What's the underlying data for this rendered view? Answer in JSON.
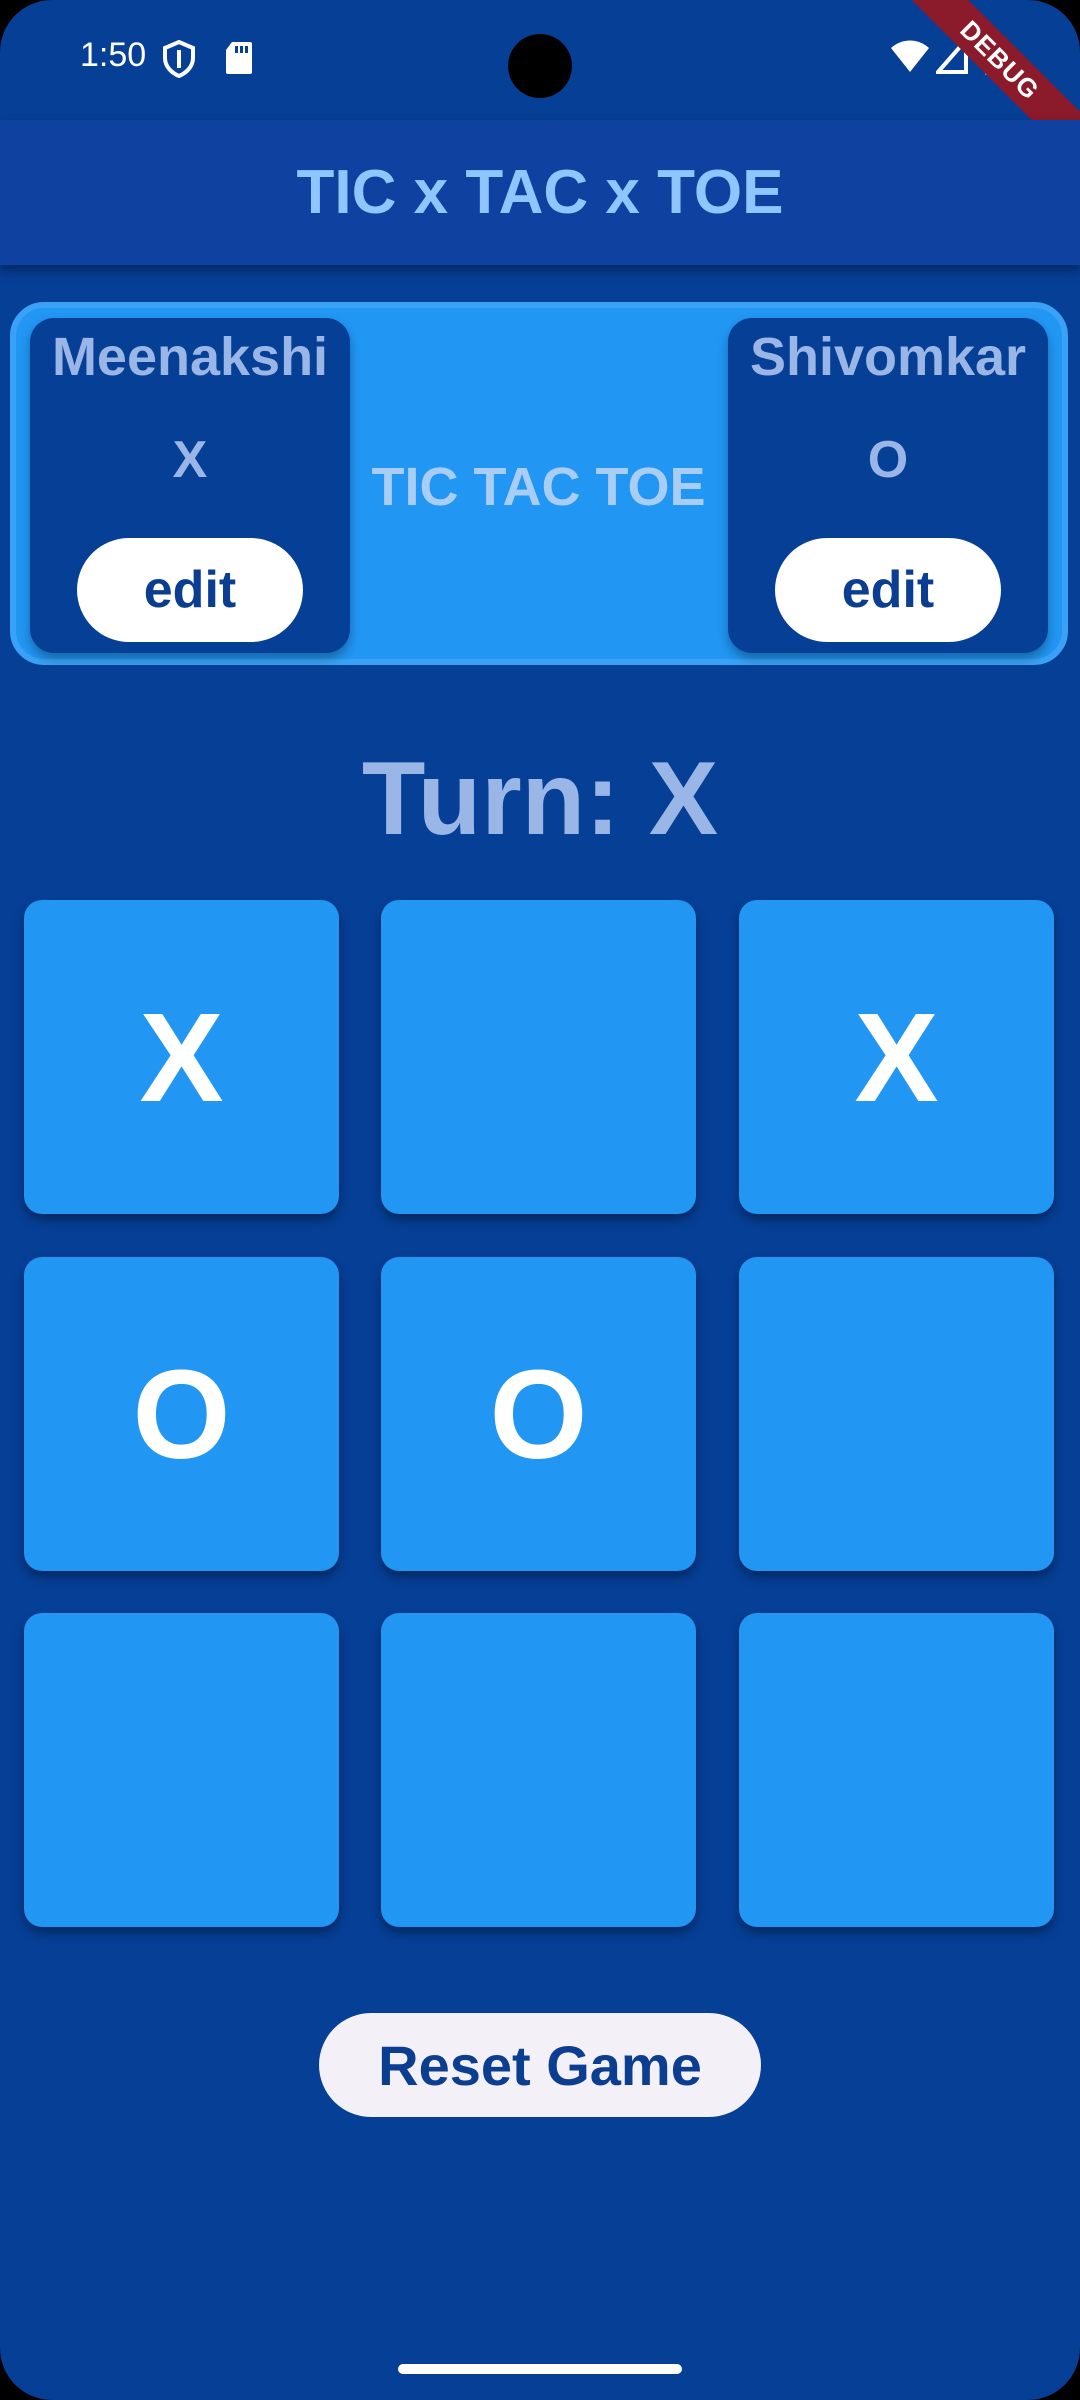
{
  "status_bar": {
    "time": "1:50",
    "icons": [
      "shield-icon",
      "sd-card-icon",
      "wifi-icon",
      "signal-icon",
      "battery-icon"
    ]
  },
  "debug_banner": "DEBUG",
  "app_bar": {
    "title": "TIC x TAC x TOE"
  },
  "players": {
    "left": {
      "name": "Meenakshi",
      "symbol": "X",
      "edit_label": "edit"
    },
    "right": {
      "name": "Shivomkar",
      "symbol": "O",
      "edit_label": "edit"
    },
    "center_title": "TIC TAC TOE"
  },
  "turn": {
    "text": "Turn: X"
  },
  "board": {
    "cells": [
      "X",
      "",
      "X",
      "O",
      "O",
      "",
      "",
      "",
      ""
    ]
  },
  "reset_label": "Reset Game",
  "colors": {
    "background": "#063f96",
    "app_bar": "#0e41a0",
    "cell": "#2196f3",
    "title_text": "#8fc6ff",
    "muted_text": "#9ab6e6",
    "button_text": "#0b3d91"
  }
}
